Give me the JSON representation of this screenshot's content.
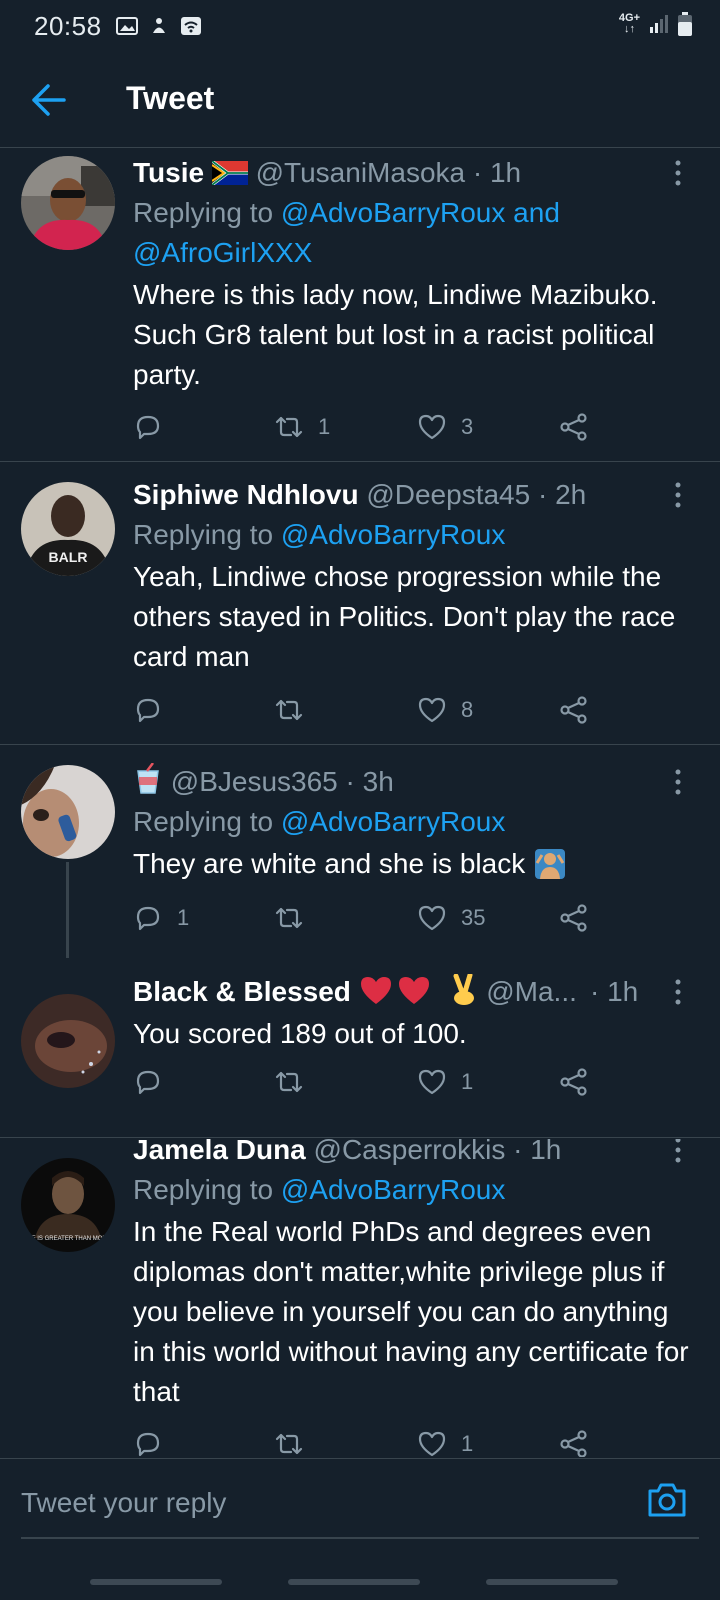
{
  "status_bar": {
    "time": "20:58",
    "network": "4G+"
  },
  "header": {
    "title": "Tweet"
  },
  "tweets": [
    {
      "name": "Tusie",
      "handle": "@TusaniMasoka",
      "time": "· 1h",
      "replying_prefix": "Replying to",
      "mentions": [
        "@AdvoBarryRoux",
        "and",
        "@AfroGirlXXX"
      ],
      "text": "Where is this lady now, Lindiwe Mazibuko. Such Gr8 talent but lost in a racist political party.",
      "reply_count": "",
      "retweet_count": "1",
      "like_count": "3"
    },
    {
      "name": "Siphiwe Ndhlovu",
      "handle": "@Deepsta45",
      "time": "· 2h",
      "replying_prefix": "Replying to",
      "mentions": [
        "@AdvoBarryRoux"
      ],
      "text": "Yeah, Lindiwe chose progression while the others stayed in Politics. Don't play the race card man",
      "reply_count": "",
      "retweet_count": "",
      "like_count": "8"
    },
    {
      "name": "",
      "handle": "@BJesus365",
      "time": "· 3h",
      "replying_prefix": "Replying to",
      "mentions": [
        "@AdvoBarryRoux"
      ],
      "text": "They are white and she is black",
      "reply_count": "1",
      "retweet_count": "",
      "like_count": "35"
    },
    {
      "name": "Black & Blessed",
      "handle": "@Ma...",
      "time": "· 1h",
      "text": "You scored 189 out of 100.",
      "reply_count": "",
      "retweet_count": "",
      "like_count": "1"
    },
    {
      "name": "Jamela Duna",
      "handle": "@Casperrokkis",
      "time": "· 1h",
      "replying_prefix": "Replying to",
      "mentions": [
        "@AdvoBarryRoux"
      ],
      "text": "In the Real world PhDs and degrees even diplomas don't matter,white privilege plus if you believe in yourself you can do anything in this world without having any certificate for that",
      "avatar_caption": "TIME IS GREATER THAN MONEY",
      "reply_count": "",
      "retweet_count": "",
      "like_count": "1"
    }
  ],
  "avatar_texts": {
    "siphiwe_shirt": "BALR"
  },
  "reply_bar": {
    "placeholder": "Tweet your reply"
  },
  "colors": {
    "background": "#15202b",
    "accent": "#1da1f2",
    "muted": "#8899a6",
    "divider": "#38444d"
  }
}
